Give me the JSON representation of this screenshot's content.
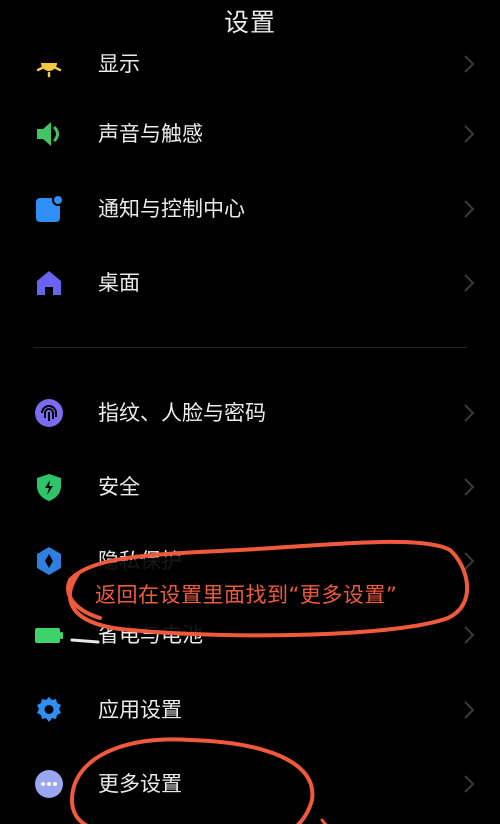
{
  "header": {
    "title": "设置"
  },
  "groups": [
    {
      "items": [
        {
          "label": "显示",
          "icon": "brightness-icon",
          "color": "#f5c842"
        },
        {
          "label": "声音与触感",
          "icon": "speaker-icon",
          "color": "#43c463"
        },
        {
          "label": "通知与控制中心",
          "icon": "notification-icon",
          "color": "#2f8ff5"
        },
        {
          "label": "桌面",
          "icon": "home-icon",
          "color": "#6a62f0"
        }
      ]
    },
    {
      "items": [
        {
          "label": "指纹、人脸与密码",
          "icon": "fingerprint-icon",
          "color": "#7a6cf0"
        },
        {
          "label": "安全",
          "icon": "shield-icon",
          "color": "#2fc46a"
        },
        {
          "label": "隐私保护",
          "icon": "privacy-icon",
          "color": "#2f7fe0"
        },
        {
          "label": "省电与电池",
          "icon": "battery-icon",
          "color": "#3ed36a"
        },
        {
          "label": "应用设置",
          "icon": "gear-icon",
          "color": "#2f8ff5"
        },
        {
          "label": "更多设置",
          "icon": "more-icon",
          "color": "#9aa6f0"
        }
      ]
    }
  ],
  "annotation": {
    "text": "返回在设置里面找到“更多设置”",
    "color": "#f05a3c"
  }
}
